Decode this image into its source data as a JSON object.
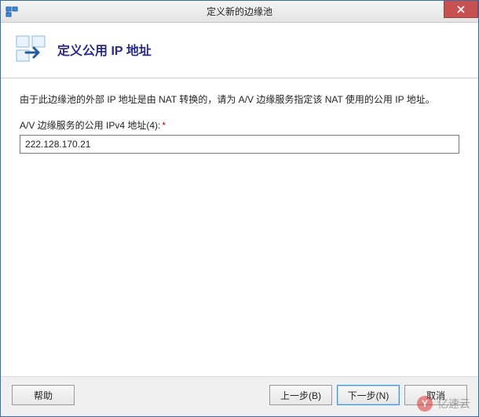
{
  "window": {
    "title": "定义新的边缘池"
  },
  "header": {
    "title": "定义公用 IP 地址"
  },
  "content": {
    "description": "由于此边缘池的外部 IP 地址是由 NAT 转换的，请为 A/V 边缘服务指定该 NAT 使用的公用 IP 地址。",
    "ipv4_label": "A/V 边缘服务的公用 IPv4 地址(4):",
    "ipv4_required_mark": "*",
    "ipv4_value": "222.128.170.21"
  },
  "footer": {
    "help": "帮助",
    "back": "上一步(B)",
    "next": "下一步(N)",
    "cancel": "取消"
  },
  "watermark": {
    "text": "亿速云"
  }
}
